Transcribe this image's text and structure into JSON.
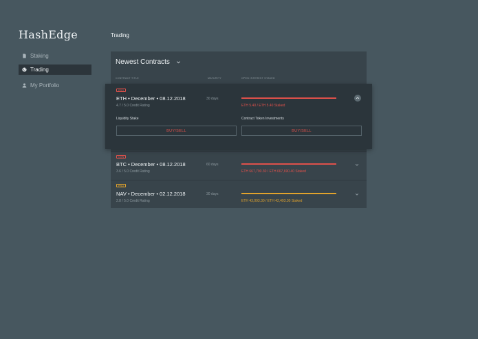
{
  "app": {
    "name": "HashEdge"
  },
  "sidebar": {
    "items": [
      {
        "label": "Staking",
        "icon": "file-icon",
        "active": false
      },
      {
        "label": "Trading",
        "icon": "globe-icon",
        "active": true
      },
      {
        "label": "My Portfolio",
        "icon": "person-icon",
        "active": false
      }
    ]
  },
  "page": {
    "title": "Trading"
  },
  "contracts": {
    "heading": "Newest Contracts",
    "columns": [
      "CONTRACT TITLE",
      "MATURITY",
      "OPEN INTEREST STAKED"
    ],
    "rows": [
      {
        "badge": "PRO",
        "badge_color": "#e0514b",
        "title": "ETH • December • 08.12.2018",
        "rating": "4.7 / 5.0 Credit Rating",
        "maturity": "30 days",
        "staked": "ETH 5.40 / ETH 5.40 Staked",
        "bar_color": "#e0514b",
        "fill": 1.0,
        "expanded": true,
        "liquidity_label": "Liquidity Stake",
        "investment_label": "Contract Token Investments",
        "buy_label": "BUY/SELL"
      },
      {
        "badge": "CON",
        "badge_color": "#e0514b",
        "title": "BTC • December • 08.12.2018",
        "rating": "3.6 / 5.0 Credit Rating",
        "maturity": "60 days",
        "staked": "ETH 667,790.30 / ETH 667,690.40 Staked",
        "bar_color": "#e0514b",
        "fill": 1.0,
        "expanded": false
      },
      {
        "badge": "PRO",
        "badge_color": "#e2a32c",
        "title": "NAV • December • 02.12.2018",
        "rating": "2.8 / 5.0 Credit Rating",
        "maturity": "30 days",
        "staked": "ETH 43,093.30 / ETH 42,493.30 Staked",
        "bar_color": "#e2a32c",
        "fill": 1.0,
        "expanded": false
      }
    ]
  }
}
